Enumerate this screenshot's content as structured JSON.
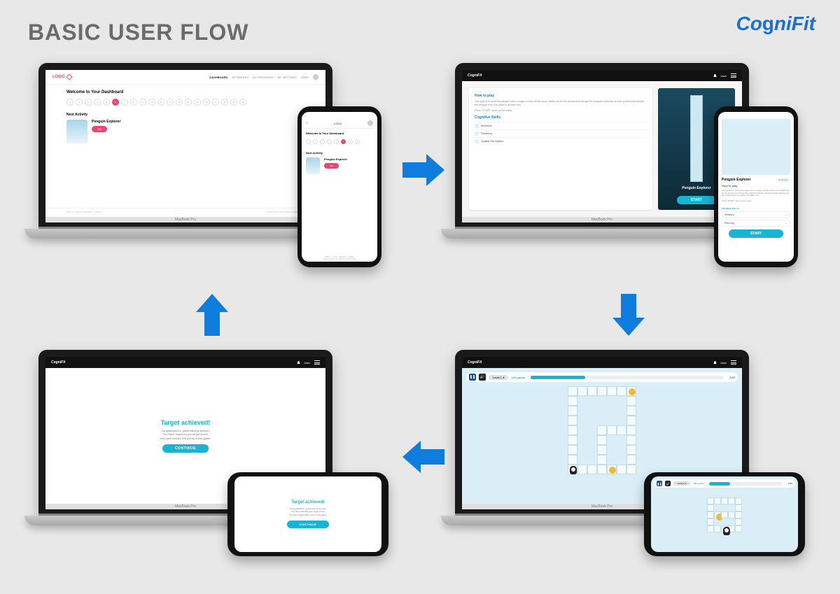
{
  "page": {
    "title": "BASIC USER FLOW",
    "brand": "CogniFit"
  },
  "devices": {
    "macbook_label": "MacBook Pro"
  },
  "dashboard": {
    "logo_text": "LOGO",
    "nav": [
      "DASHBOARD",
      "MY BADGES",
      "MY PROGRESS",
      "MY SETTINGS",
      "USER"
    ],
    "welcome": "Welcome to Your Dashboard",
    "steps": [
      "1",
      "2",
      "3",
      "4",
      "5",
      "6",
      "7",
      "8",
      "9",
      "10",
      "11",
      "12",
      "13",
      "14",
      "15",
      "16",
      "17",
      "18",
      "19",
      "20"
    ],
    "active_step_index": 5,
    "next_activity_heading": "Next Activity",
    "activity_title": "Penguin Explorer",
    "go_label": "GO",
    "footer_left": "ABOUT  |  LEGAL  |  PRIVACY  |  PRESS",
    "footer_right": "©2021 LOGO. ALL RIGHTS RESERVED"
  },
  "instructions": {
    "brand": "CogniFit",
    "user_label": "User",
    "how_to_play_heading": "How to play",
    "how_to_play_text": "Your goal is to move the penguin who is eager to clear all the snow. Watch out for the arrows that change the penguin's direction and the portals that teleport the penguin from one place to another one.",
    "press_start": "Press \"START\" when you're ready.",
    "cognitive_heading": "Cognitive Skills",
    "skills": [
      "Inhibition",
      "Planning",
      "Spatial Perception"
    ],
    "game_title": "Penguin Explorer",
    "start_label": "START",
    "duration_tag": "4 minutes",
    "trained_heading": "TRAINED SKILLS",
    "trained": [
      "Inhibition",
      "Planning"
    ]
  },
  "gameplay": {
    "brand": "CogniFit",
    "user_label": "User",
    "level_label": "Level 1-8",
    "points_label": "220 points",
    "timer": "2:07",
    "phone_level": "Level 1-4",
    "phone_points": "120 points",
    "phone_timer": "2:53"
  },
  "results": {
    "brand": "CogniFit",
    "user_label": "User",
    "title": "Target achieved!",
    "line1": "Congratulations, great training session!",
    "line2": "You have reached your target score!",
    "line3": "You have scored 300 points in this game.",
    "continue_label": "CONTINUE"
  }
}
